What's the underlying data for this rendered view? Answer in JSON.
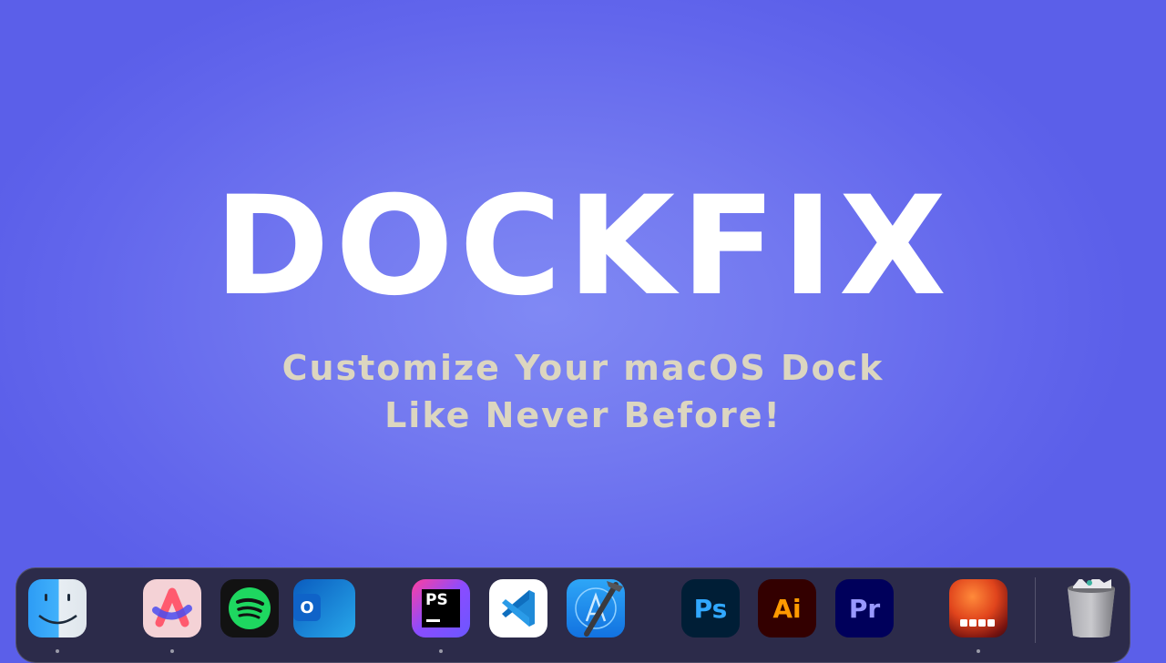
{
  "hero": {
    "title": "DOCKFIX",
    "subtitle_line1": "Customize Your macOS Dock",
    "subtitle_line2": "Like Never Before!"
  },
  "colors": {
    "background": "#6266ec",
    "title": "#ffffff",
    "subtitle": "#dcd6c0",
    "dock": "#2c2b4a"
  },
  "dock": {
    "apps": [
      {
        "name": "Finder",
        "icon": "finder-icon",
        "running": true
      },
      {
        "name": "Arc",
        "icon": "arc-browser-icon",
        "running": true
      },
      {
        "name": "Spotify",
        "icon": "spotify-icon",
        "running": false
      },
      {
        "name": "Outlook",
        "icon": "outlook-icon",
        "running": false,
        "glyph": "O"
      },
      {
        "name": "PhpStorm",
        "icon": "phpstorm-icon",
        "running": true,
        "glyph": "PS"
      },
      {
        "name": "Visual Studio Code",
        "icon": "vscode-icon",
        "running": false
      },
      {
        "name": "Xcode",
        "icon": "xcode-icon",
        "running": false
      },
      {
        "name": "Photoshop",
        "icon": "photoshop-icon",
        "running": false,
        "glyph": "Ps"
      },
      {
        "name": "Illustrator",
        "icon": "illustrator-icon",
        "running": false,
        "glyph": "Ai"
      },
      {
        "name": "Premiere Pro",
        "icon": "premiere-icon",
        "running": false,
        "glyph": "Pr"
      },
      {
        "name": "DockFix",
        "icon": "dockfix-icon",
        "running": true
      },
      {
        "name": "Trash",
        "icon": "trash-icon",
        "running": false
      }
    ]
  }
}
